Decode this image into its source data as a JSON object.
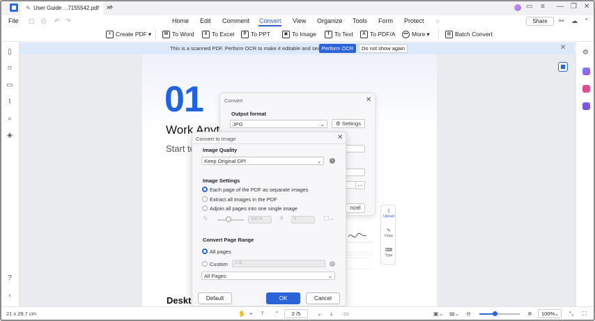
{
  "titlebar": {
    "tab_title": "User Guide ...7155542.pdf",
    "new_tab": "+"
  },
  "menubar": {
    "file": "File",
    "items": [
      "Home",
      "Edit",
      "Comment",
      "Convert",
      "View",
      "Organize",
      "Tools",
      "Form",
      "Protect"
    ],
    "active": "Convert",
    "share": "Share"
  },
  "toolbar": {
    "create_pdf": "Create PDF",
    "to_word": "To Word",
    "to_excel": "To Excel",
    "to_ppt": "To PPT",
    "to_image": "To Image",
    "to_text": "To Text",
    "to_pdfa": "To PDF/A",
    "more": "More",
    "batch_convert": "Batch Convert"
  },
  "banner": {
    "message": "This is a scanned PDF. Perform OCR to make it editable and searchable.",
    "ocr_button": "Perform OCR",
    "dismiss_button": "Do not show again"
  },
  "document": {
    "number": "01",
    "title": "Work Anyt",
    "subtitle": "Start to",
    "heading": "Deskto"
  },
  "convert_dialog": {
    "title": "Convert",
    "output_format_label": "Output format",
    "output_format_value": "JPG",
    "settings_button": "Settings",
    "cancel_partial": "ncel"
  },
  "right_tool_panel": {
    "upload": "Upload",
    "draw": "Draw",
    "type": "Type"
  },
  "image_dialog": {
    "title": "Convert to Image",
    "quality_label": "Image Quality",
    "quality_value": "Keep Original DPI",
    "settings_label": "Image Settings",
    "options": [
      "Each page of the PDF as separate images",
      "Extract all images in the PDF",
      "Adjoin all pages into one single image"
    ],
    "selected_option": 0,
    "percent_value": "100 %",
    "count_value": "5",
    "range_label": "Convert Page Range",
    "all_pages": "All pages",
    "custom": "Custom",
    "custom_value": "1 /5",
    "range_select": "All Pages",
    "default_button": "Default",
    "ok_button": "OK",
    "cancel_button": "Cancel"
  },
  "statusbar": {
    "page_size": "21 x 29.7 cm",
    "page_indicator": "2 /5",
    "zoom": "100%"
  }
}
